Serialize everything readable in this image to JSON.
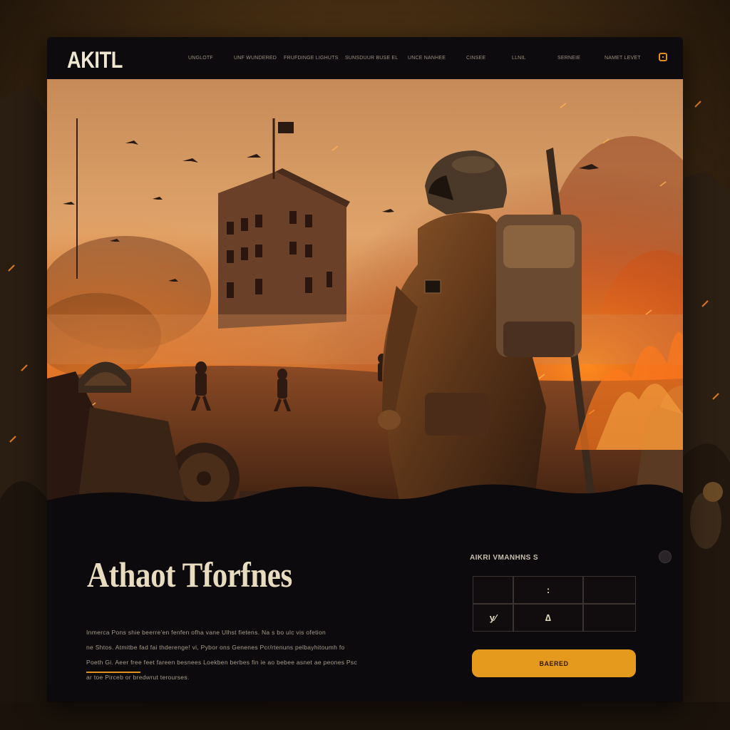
{
  "app": {
    "logo": "AKITL"
  },
  "nav": {
    "items": [
      "UNGLOTF",
      "UNF WUNDERED",
      "FRUFDINGE LIGHUTS",
      "SUNSDUUR BUSE EL",
      "UNCE NANHEE",
      "CINSEE",
      "LLNIL",
      "SERNEIE",
      "NAMET LEVET"
    ]
  },
  "hero": {
    "accent_color": "#e2901c",
    "headline": "Athaot Tforfnes",
    "paragraph": [
      "Inmerca Pons shie beerre'en fenfen ofha vane Ulhst fietens. Na s bo ulc vis ofetion",
      "ne Shtos. Atmitbe fad fai thderenge! vi, Pybor ons Genenes Pcr/rtenuns pelbayhitoumh fo",
      "Poeth Gi. Aeer free feet fareen besnees Loekben berbes fin ie ao bebee asnet ae peones Psc",
      "ar toe Pirceb or bredwrut terourses."
    ]
  },
  "panel": {
    "title": "AIKRI VMANHNS S",
    "cells": [
      "",
      ":",
      "",
      "у∕",
      "∆",
      ""
    ],
    "cta_label": "BAERED"
  },
  "colors": {
    "accent": "#e59a1e",
    "panel_bg": "#0d0a0d",
    "text_light": "#e8dcbf"
  }
}
